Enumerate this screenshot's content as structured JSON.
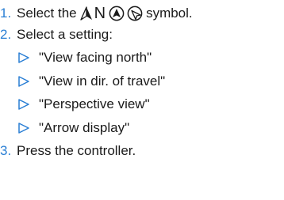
{
  "steps": [
    {
      "number": "1.",
      "text_before": "Select the",
      "text_after": "symbol.",
      "symbols": [
        "compass-arrow-icon",
        "north-letter-icon",
        "perspective-arrow-filled-icon",
        "perspective-arrow-outline-icon"
      ],
      "north_glyph": "N"
    },
    {
      "number": "2.",
      "text": "Select a setting:"
    },
    {
      "number": "3.",
      "text": "Press the controller."
    }
  ],
  "options": [
    "\"View facing north\"",
    "\"View in dir. of travel\"",
    "\"Perspective view\"",
    "\"Arrow display\""
  ],
  "colors": {
    "step_number": "#2a7fd4",
    "bullet_triangle": "#2a7fd4",
    "text": "#1a1a1a"
  }
}
